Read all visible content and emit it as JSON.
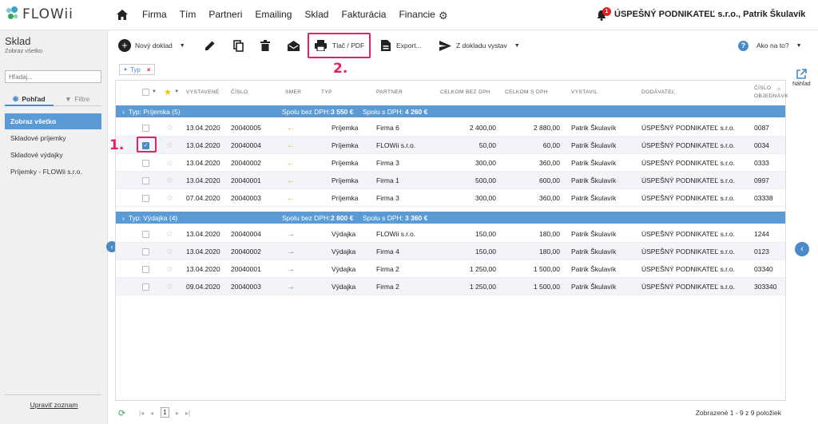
{
  "app": {
    "logo": "FLOWii"
  },
  "nav": [
    "Firma",
    "Tím",
    "Partneri",
    "Emailing",
    "Sklad",
    "Fakturácia",
    "Financie"
  ],
  "user": {
    "name": "ÚSPEŠNÝ PODNIKATEĽ s.r.o., Patrik Škulavík",
    "notifications": "1"
  },
  "sidebar": {
    "title": "Sklad",
    "subtitle": "Zobraz všetko",
    "search_placeholder": "Hľadaj...",
    "tabs": [
      "Pohľad",
      "Filtre"
    ],
    "items": [
      "Zobraz všetko",
      "Skladové príjemky",
      "Skladové výdajky",
      "Príjemky - FLOWii s.r.o."
    ],
    "footer": "Upraviť zoznam"
  },
  "toolbar": {
    "new": "Nový doklad",
    "print": "Tlač / PDF",
    "export": "Export...",
    "from_doc": "Z dokladu vystav",
    "help": "Ako na to?"
  },
  "side_right": {
    "preview": "Náhľad"
  },
  "filter_chip": "Typ",
  "steps": {
    "one": "1.",
    "two": "2."
  },
  "columns": {
    "issued": "VYSTAVENÉ",
    "number": "ČÍSLO",
    "direction": "SMER",
    "type": "TYP",
    "partner": "PARTNER",
    "total_no_vat": "CELKOM BEZ DPH",
    "total_vat": "CELKOM S DPH",
    "issued_by": "VYSTAVIL",
    "supplier": "DODÁVATEĽ",
    "order_no_1": "ČÍSLO",
    "order_no_2": "OBJEDNÁVK"
  },
  "groups": [
    {
      "label": "Typ: Príjemka (5)",
      "sum_no_vat_label": "Spolu bez DPH:",
      "sum_no_vat": "3 550 €",
      "sum_vat_label": "Spolu s DPH:",
      "sum_vat": "4 260 €",
      "rows": [
        {
          "date": "13.04.2020",
          "number": "20040005",
          "type": "Príjemka",
          "partner": "Firma 6",
          "no_vat": "2 400,00",
          "vat": "2 880,00",
          "issued_by": "Patrik Škulavík",
          "supplier": "ÚSPEŠNÝ PODNIKATEĽ s.r.o.",
          "order": "0087",
          "checked": false
        },
        {
          "date": "13.04.2020",
          "number": "20040004",
          "type": "Príjemka",
          "partner": "FLOWii s.r.o.",
          "no_vat": "50,00",
          "vat": "60,00",
          "issued_by": "Patrik Škulavík",
          "supplier": "ÚSPEŠNÝ PODNIKATEĽ s.r.o.",
          "order": "0034",
          "checked": true
        },
        {
          "date": "13.04.2020",
          "number": "20040002",
          "type": "Príjemka",
          "partner": "Firma 3",
          "no_vat": "300,00",
          "vat": "360,00",
          "issued_by": "Patrik Škulavík",
          "supplier": "ÚSPEŠNÝ PODNIKATEĽ s.r.o.",
          "order": "0333",
          "checked": false
        },
        {
          "date": "13.04.2020",
          "number": "20040001",
          "type": "Príjemka",
          "partner": "Firma 1",
          "no_vat": "500,00",
          "vat": "600,00",
          "issued_by": "Patrik Škulavík",
          "supplier": "ÚSPEŠNÝ PODNIKATEĽ s.r.o.",
          "order": "0997",
          "checked": false
        },
        {
          "date": "07.04.2020",
          "number": "20040003",
          "type": "Príjemka",
          "partner": "Firma 3",
          "no_vat": "300,00",
          "vat": "360,00",
          "issued_by": "Patrik Škulavík",
          "supplier": "ÚSPEŠNÝ PODNIKATEĽ s.r.o.",
          "order": "03338",
          "checked": false
        }
      ]
    },
    {
      "label": "Typ: Výdajka (4)",
      "sum_no_vat_label": "Spolu bez DPH:",
      "sum_no_vat": "2 800 €",
      "sum_vat_label": "Spolu s DPH:",
      "sum_vat": "3 360 €",
      "rows": [
        {
          "date": "13.04.2020",
          "number": "20040004",
          "type": "Výdajka",
          "partner": "FLOWii s.r.o.",
          "no_vat": "150,00",
          "vat": "180,00",
          "issued_by": "Patrik Škulavík",
          "supplier": "ÚSPEŠNÝ PODNIKATEĽ s.r.o.",
          "order": "1244",
          "checked": false
        },
        {
          "date": "13.04.2020",
          "number": "20040002",
          "type": "Výdajka",
          "partner": "Firma 4",
          "no_vat": "150,00",
          "vat": "180,00",
          "issued_by": "Patrik Škulavík",
          "supplier": "ÚSPEŠNÝ PODNIKATEĽ s.r.o.",
          "order": "0123",
          "checked": false
        },
        {
          "date": "13.04.2020",
          "number": "20040001",
          "type": "Výdajka",
          "partner": "Firma 2",
          "no_vat": "1 250,00",
          "vat": "1 500,00",
          "issued_by": "Patrik Škulavík",
          "supplier": "ÚSPEŠNÝ PODNIKATEĽ s.r.o.",
          "order": "03340",
          "checked": false
        },
        {
          "date": "09.04.2020",
          "number": "20040003",
          "type": "Výdajka",
          "partner": "Firma 2",
          "no_vat": "1 250,00",
          "vat": "1 500,00",
          "issued_by": "Patrik Škulavík",
          "supplier": "ÚSPEŠNÝ PODNIKATEĽ s.r.o.",
          "order": "303340",
          "checked": false
        }
      ]
    }
  ],
  "pager": {
    "page": "1",
    "info": "Zobrazené 1 - 9 z 9 položiek"
  },
  "colors": {
    "accent": "#5b9bd5",
    "highlight": "#e91e63",
    "incoming": "#e8b400",
    "outgoing": "#4a8ac8"
  }
}
